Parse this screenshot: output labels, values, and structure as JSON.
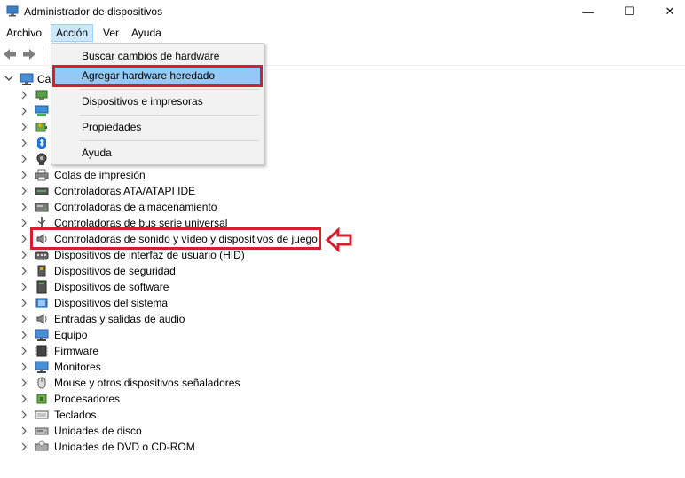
{
  "window": {
    "title": "Administrador de dispositivos",
    "controls": {
      "minimize": "—",
      "maximize": "☐",
      "close": "✕"
    }
  },
  "menubar": {
    "archivo": "Archivo",
    "accion": "Acción",
    "ver": "Ver",
    "ayuda": "Ayuda"
  },
  "dropdown": {
    "items": [
      {
        "label": "Buscar cambios de hardware"
      },
      {
        "label": "Agregar hardware heredado"
      },
      {
        "label": "Dispositivos e impresoras"
      },
      {
        "label": "Propiedades"
      },
      {
        "label": "Ayuda"
      }
    ]
  },
  "tree": {
    "root_label": "Ca",
    "items": [
      {
        "label": "",
        "icon": "audio-input-icon"
      },
      {
        "label": "",
        "icon": "network-icon"
      },
      {
        "label": "",
        "icon": "battery-icon"
      },
      {
        "label": "",
        "icon": "bluetooth-icon"
      },
      {
        "label": "",
        "icon": "camera-icon"
      },
      {
        "label": "Colas de impresión",
        "icon": "printer-icon"
      },
      {
        "label": "Controladoras ATA/ATAPI IDE",
        "icon": "ide-controller-icon"
      },
      {
        "label": "Controladoras de almacenamiento",
        "icon": "storage-controller-icon"
      },
      {
        "label": "Controladoras de bus serie universal",
        "icon": "usb-icon"
      },
      {
        "label": "Controladoras de sonido y vídeo y dispositivos de juego",
        "icon": "speaker-icon"
      },
      {
        "label": "Dispositivos de interfaz de usuario (HID)",
        "icon": "hid-icon"
      },
      {
        "label": "Dispositivos de seguridad",
        "icon": "security-device-icon"
      },
      {
        "label": "Dispositivos de software",
        "icon": "software-device-icon"
      },
      {
        "label": "Dispositivos del sistema",
        "icon": "system-device-icon"
      },
      {
        "label": "Entradas y salidas de audio",
        "icon": "speaker-icon"
      },
      {
        "label": "Equipo",
        "icon": "monitor-icon"
      },
      {
        "label": "Firmware",
        "icon": "firmware-icon"
      },
      {
        "label": "Monitores",
        "icon": "monitor-icon"
      },
      {
        "label": "Mouse y otros dispositivos señaladores",
        "icon": "mouse-icon"
      },
      {
        "label": "Procesadores",
        "icon": "processor-icon"
      },
      {
        "label": "Teclados",
        "icon": "keyboard-icon"
      },
      {
        "label": "Unidades de disco",
        "icon": "disk-drive-icon"
      },
      {
        "label": "Unidades de DVD o CD-ROM",
        "icon": "dvd-drive-icon"
      }
    ]
  },
  "colors": {
    "menu_highlight": "#91c9f7",
    "menu_active": "#cce8ff",
    "annotation_red": "#d2202f"
  }
}
